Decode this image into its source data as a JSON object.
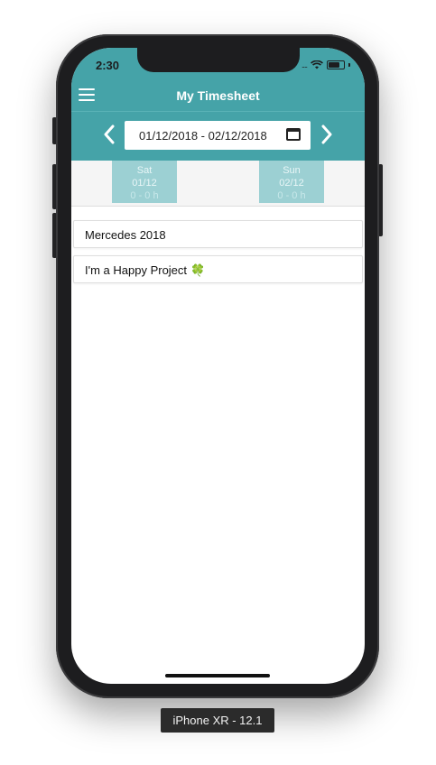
{
  "status": {
    "time": "2:30",
    "signal": "....",
    "wifi_icon": "wifi-icon",
    "battery_icon": "battery-icon"
  },
  "header": {
    "title": "My Timesheet",
    "menu_icon": "menu-icon",
    "color": "#45a3a8"
  },
  "date_range": {
    "text": "01/12/2018 - 02/12/2018",
    "prev_icon": "chevron-left-icon",
    "next_icon": "chevron-right-icon",
    "calendar_icon": "calendar-icon"
  },
  "days": [
    {
      "weekday": "Sat",
      "date": "01/12",
      "hours": "0 - 0 h"
    },
    {
      "weekday": "Sun",
      "date": "02/12",
      "hours": "0 - 0 h"
    }
  ],
  "projects": [
    {
      "label": "Mercedes 2018"
    },
    {
      "label": "I'm a Happy Project",
      "emoji": "🍀"
    }
  ],
  "device": {
    "label": "iPhone XR - 12.1"
  }
}
